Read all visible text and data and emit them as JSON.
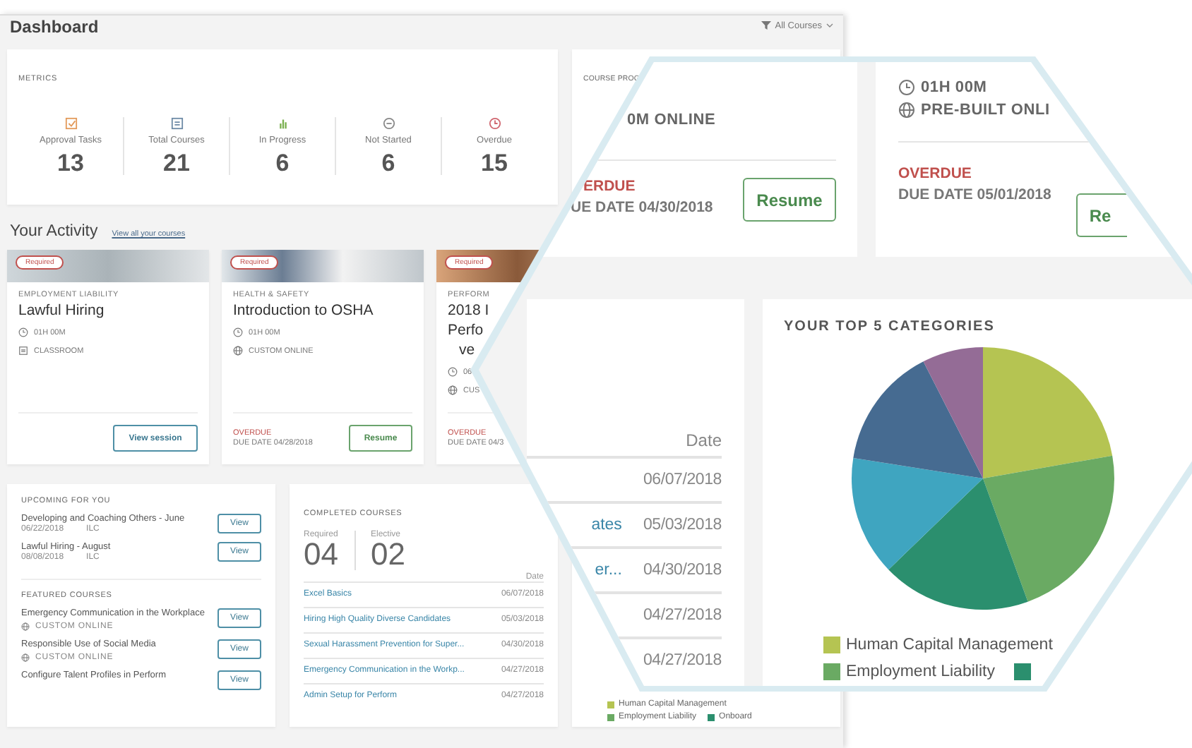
{
  "header": {
    "title": "Dashboard",
    "filter": "All Courses"
  },
  "metrics": {
    "title": "METRICS",
    "items": [
      {
        "kind": "approval",
        "label": "Approval Tasks",
        "value": "13"
      },
      {
        "kind": "total",
        "label": "Total Courses",
        "value": "21"
      },
      {
        "kind": "progress",
        "label": "In Progress",
        "value": "6"
      },
      {
        "kind": "not_started",
        "label": "Not Started",
        "value": "6"
      },
      {
        "kind": "overdue",
        "label": "Overdue",
        "value": "15"
      }
    ]
  },
  "course_progress": {
    "title": "COURSE PROG"
  },
  "activity": {
    "title": "Your Activity",
    "link": "View all your courses",
    "cards": [
      {
        "badge": "Required",
        "category": "EMPLOYMENT LIABILITY",
        "title_lines": [
          "Lawful Hiring"
        ],
        "meta": [
          {
            "kind": "clock",
            "text": "01H 00M"
          },
          {
            "kind": "classroom",
            "text": "CLASSROOM"
          }
        ],
        "button": {
          "kind": "view",
          "label": "View session"
        }
      },
      {
        "badge": "Required",
        "category": "HEALTH & SAFETY",
        "title_lines": [
          "Introduction to OSHA"
        ],
        "meta": [
          {
            "kind": "clock",
            "text": "01H 00M"
          },
          {
            "kind": "online",
            "text": "CUSTOM ONLINE"
          }
        ],
        "status": "OVERDUE",
        "due": "DUE DATE 04/28/2018",
        "button": {
          "kind": "resume",
          "label": "Resume"
        }
      },
      {
        "badge": "Required",
        "category": "PERFORM",
        "title_lines": [
          "2018 I",
          "Perfo",
          "ve"
        ],
        "meta": [
          {
            "kind": "clock",
            "text": "06"
          },
          {
            "kind": "online",
            "text": "CUS"
          }
        ],
        "status": "OVERDUE",
        "due": "DUE DATE 04/3"
      }
    ]
  },
  "upcoming": {
    "title": "UPCOMING FOR YOU",
    "items": [
      {
        "title": "Developing and Coaching Others - June",
        "date": "06/22/2018",
        "type": "ILC",
        "button": "View"
      },
      {
        "title": "Lawful Hiring - August",
        "date": "08/08/2018",
        "type": "ILC",
        "button": "View"
      }
    ]
  },
  "featured": {
    "title": "FEATURED COURSES",
    "items": [
      {
        "title": "Emergency Communication in the Workplace",
        "meta": "CUSTOM ONLINE",
        "button": "View"
      },
      {
        "title": "Responsible Use of Social Media",
        "meta": "CUSTOM ONLINE",
        "button": "View"
      },
      {
        "title": "Configure Talent Profiles in Perform",
        "button": "View"
      }
    ]
  },
  "completed": {
    "title": "COMPLETED COURSES",
    "counts": [
      {
        "label": "Required",
        "value": "04"
      },
      {
        "label": "Elective",
        "value": "02"
      }
    ],
    "date_header": "Date",
    "rows": [
      {
        "title": "Excel Basics",
        "date": "06/07/2018"
      },
      {
        "title": "Hiring High Quality Diverse Candidates",
        "date": "05/03/2018"
      },
      {
        "title": "Sexual Harassment Prevention for Super...",
        "date": "04/30/2018"
      },
      {
        "title": "Emergency Communication in the Workp...",
        "date": "04/27/2018"
      },
      {
        "title": "Admin Setup for Perform",
        "date": "04/27/2018"
      }
    ]
  },
  "categories": {
    "legend": [
      {
        "label": "Human Capital Management",
        "color": "#b5c452"
      },
      {
        "label": "Employment Liability",
        "color": "#6aaa63"
      },
      {
        "label": "Onboard",
        "color": "#2b8f6e"
      }
    ]
  },
  "magnifier": {
    "progress_card": {
      "meta": "0M ONLINE",
      "status": "ERDUE",
      "due": "UE DATE 04/30/2018",
      "button": "Resume"
    },
    "course_card": {
      "meta": [
        {
          "kind": "clock",
          "text": "01H 00M"
        },
        {
          "kind": "online",
          "text": "PRE-BUILT ONLI"
        }
      ],
      "status": "OVERDUE",
      "due": "DUE DATE 05/01/2018",
      "button": "Re"
    },
    "completed": {
      "date_header": "Date",
      "rows": [
        {
          "date": "06/07/2018"
        },
        {
          "title": "ates",
          "date": "05/03/2018"
        },
        {
          "title": "er...",
          "date": "04/30/2018"
        },
        {
          "date": "04/27/2018"
        },
        {
          "date": "04/27/2018"
        }
      ]
    },
    "categories": {
      "title": "YOUR TOP 5 CATEGORIES",
      "legend": [
        {
          "label": "Human Capital Management",
          "color": "#b5c452"
        },
        {
          "label": "Employment Liability",
          "color": "#6aaa63"
        },
        {
          "color": "#2b8f6e"
        }
      ]
    }
  }
}
